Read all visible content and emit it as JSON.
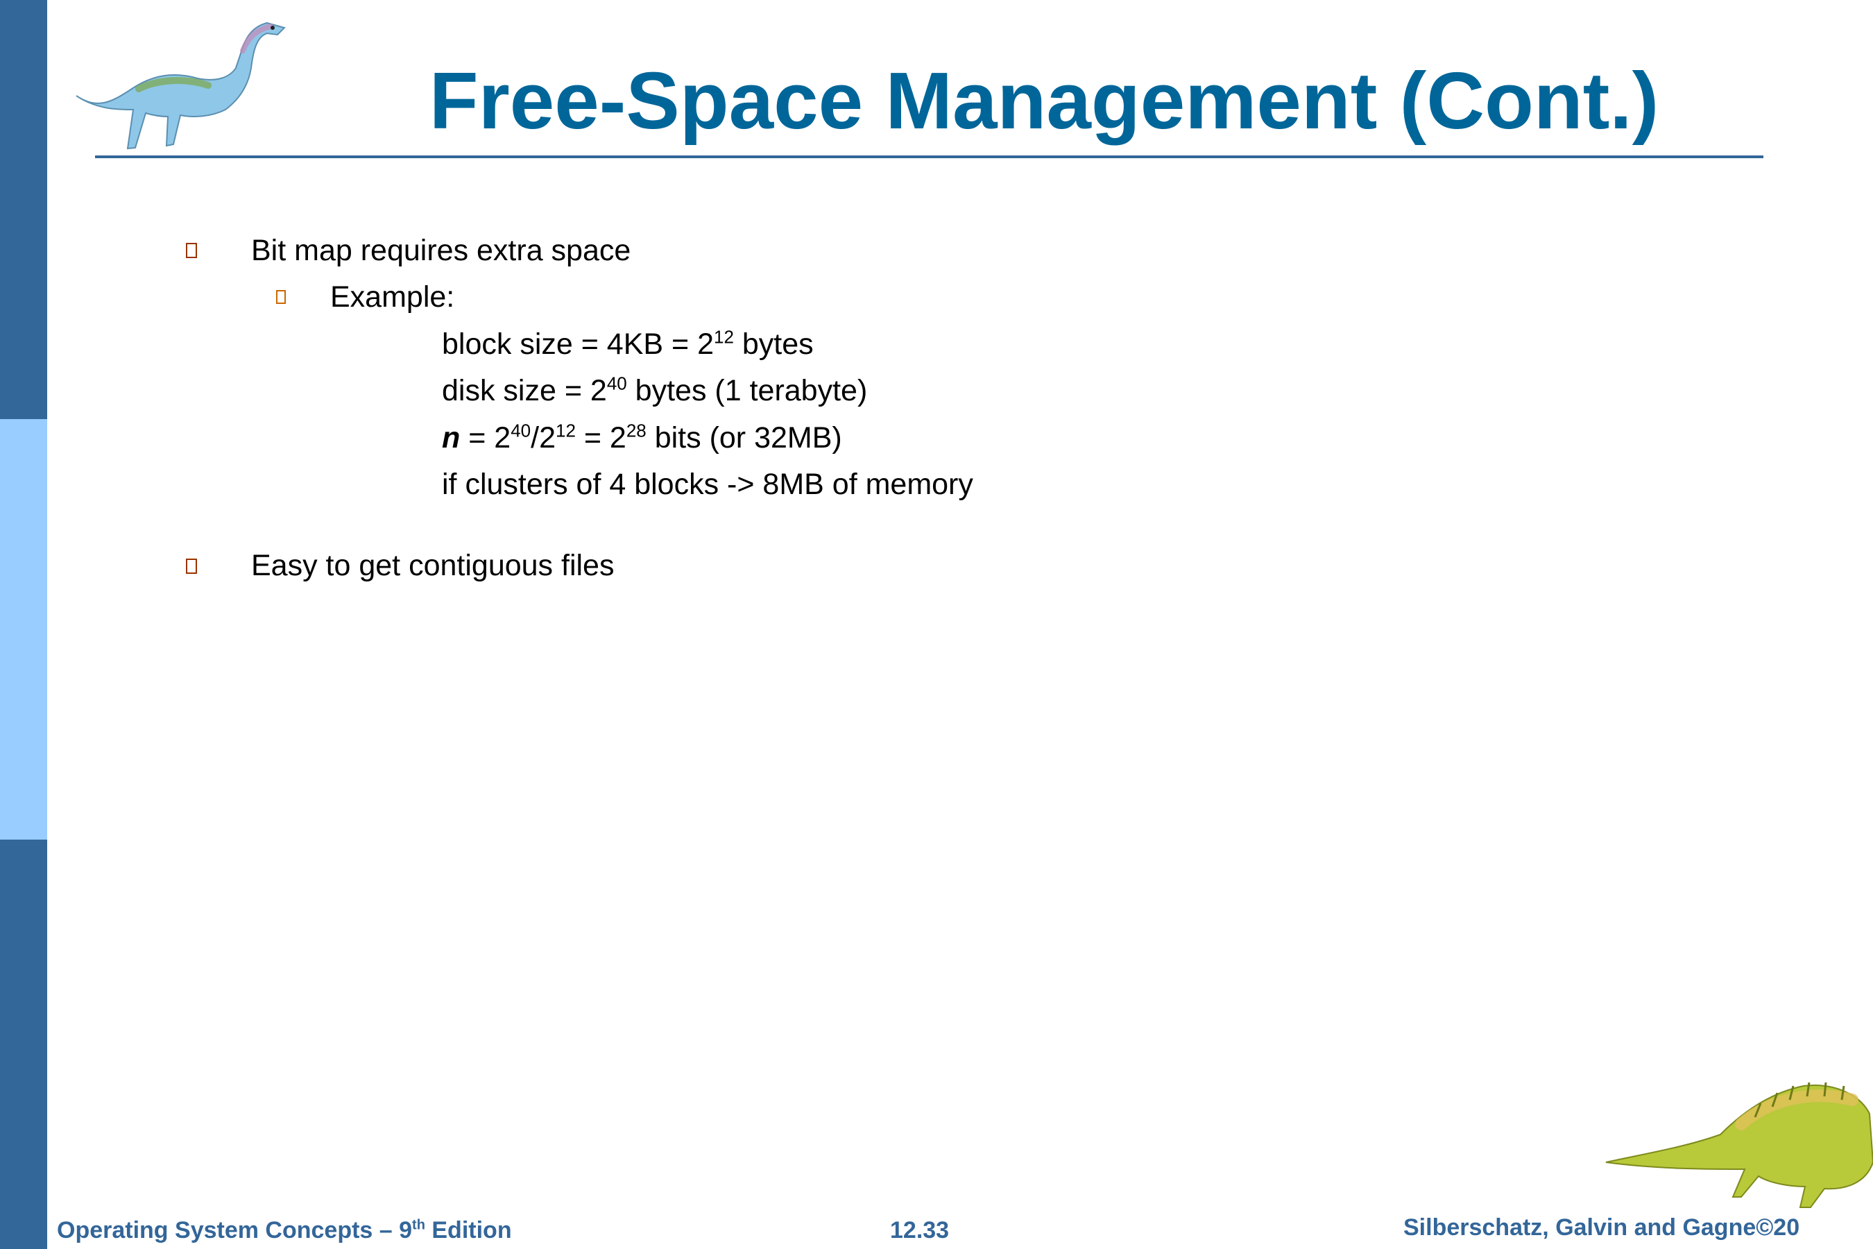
{
  "slide": {
    "title": "Free-Space Management (Cont.)",
    "bullets": [
      {
        "text": "Bit map requires extra space"
      },
      {
        "text": "Example:"
      },
      {
        "text": "Easy to get contiguous files"
      }
    ],
    "example_lines": {
      "line1": {
        "pre": "block size = 4KB =  2",
        "sup": "12",
        "post": " bytes"
      },
      "line2": {
        "pre": "disk size = 2",
        "sup": "40",
        "post": " bytes (1 terabyte)"
      },
      "line3": {
        "var": "n",
        "a": " = 2",
        "sup1": "40",
        "b": "/2",
        "sup2": "12",
        "c": " = 2",
        "sup3": "28",
        "d": " bits (or 32MB)"
      },
      "line4": {
        "text": "if clusters of 4 blocks -> 8MB of memory"
      }
    }
  },
  "footer": {
    "left_pre": "Operating System Concepts  – 9",
    "left_sup": "th",
    "left_post": " Edition",
    "center": "12.33",
    "right": "Silberschatz, Galvin and Gagne©20"
  },
  "colors": {
    "title": "#006699",
    "sidebar_dark": "#336699",
    "sidebar_light": "#99ccff",
    "bullet_marker": "#993300",
    "footer_text": "#336699"
  }
}
